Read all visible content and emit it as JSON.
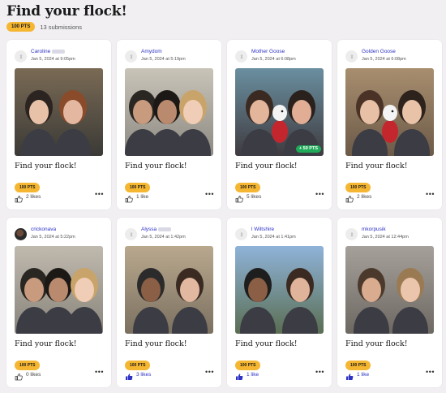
{
  "header": {
    "title": "Find your flock!",
    "points": "100 PTS",
    "submissions": "13 submissions"
  },
  "cards": [
    {
      "user": "Caroline",
      "date": "Jan 5, 2024 at 9:05pm",
      "title": "Find your flock!",
      "points": "100 PTS",
      "likes": "2 likes",
      "liked": false,
      "avatar": "placeholder",
      "bonus": ""
    },
    {
      "user": "Amydom",
      "date": "Jan 5, 2024 at 5:19pm",
      "title": "Find your flock!",
      "points": "100 PTS",
      "likes": "1 like",
      "liked": false,
      "avatar": "placeholder",
      "bonus": ""
    },
    {
      "user": "Mother Goose",
      "date": "Jan 5, 2024 at 6:08pm",
      "title": "Find your flock!",
      "points": "100 PTS",
      "likes": "5 likes",
      "liked": false,
      "avatar": "placeholder",
      "bonus": "+ 50 PTS"
    },
    {
      "user": "Golden Goose",
      "date": "Jan 5, 2024 at 6:08pm",
      "title": "Find your flock!",
      "points": "100 PTS",
      "likes": "2 likes",
      "liked": false,
      "avatar": "placeholder",
      "bonus": ""
    },
    {
      "user": "crickonava",
      "date": "Jan 5, 2024 at 5:22pm",
      "title": "Find your flock!",
      "points": "100 PTS",
      "likes": "0 likes",
      "liked": false,
      "avatar": "photo",
      "bonus": ""
    },
    {
      "user": "Alyssa",
      "date": "Jan 5, 2024 at 1:42pm",
      "title": "Find your flock!",
      "points": "100 PTS",
      "likes": "3 likes",
      "liked": true,
      "avatar": "placeholder",
      "bonus": ""
    },
    {
      "user": "l Wiltshire",
      "date": "Jan 5, 2024 at 1:41pm",
      "title": "Find your flock!",
      "points": "100 PTS",
      "likes": "1 like",
      "liked": true,
      "avatar": "placeholder",
      "bonus": ""
    },
    {
      "user": "mkorpusik",
      "date": "Jan 5, 2024 at 12:44pm",
      "title": "Find your flock!",
      "points": "100 PTS",
      "likes": "1 like",
      "liked": true,
      "avatar": "placeholder",
      "bonus": ""
    }
  ],
  "colors": {
    "accent": "#2e33c4",
    "badge": "#f5b731",
    "bonus": "#1faa59",
    "background": "#f1eff2"
  },
  "icons": {
    "avatar_placeholder": "goose-icon",
    "like": "thumbs-up-icon",
    "more": "more-options-icon"
  }
}
